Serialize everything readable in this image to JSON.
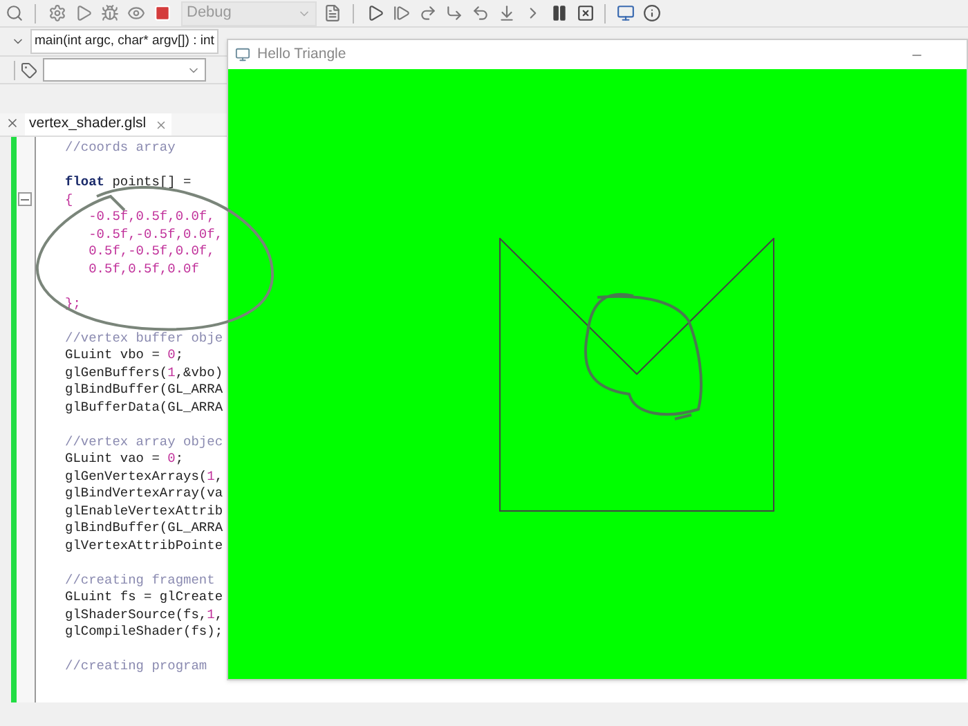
{
  "toolbar": {
    "configuration": {
      "value": "Debug",
      "disabled": true
    }
  },
  "function_selector": {
    "value": "main(int argc, char* argv[]) : int"
  },
  "tabs": [
    {
      "label": "vertex_shader.glsl",
      "selected": true
    }
  ],
  "editor": {
    "blocks": [
      {
        "lines": [
          [
            {
              "kind": "comment",
              "text": "//coords array"
            }
          ]
        ]
      },
      {
        "lines": [
          [
            {
              "kind": "keyword",
              "text": "float"
            },
            {
              "kind": "plain",
              "text": " points[] ="
            }
          ],
          [
            {
              "kind": "number",
              "text": "{"
            }
          ],
          [
            {
              "kind": "number",
              "text": "   -0.5f,0.5f,0.0f,"
            }
          ],
          [
            {
              "kind": "number",
              "text": "   -0.5f,-0.5f,0.0f,"
            }
          ],
          [
            {
              "kind": "number",
              "text": "   0.5f,-0.5f,0.0f,"
            }
          ],
          [
            {
              "kind": "number",
              "text": "   0.5f,0.5f,0.0f"
            }
          ]
        ]
      },
      {
        "lines": [
          [
            {
              "kind": "number",
              "text": "};"
            }
          ]
        ]
      },
      {
        "lines": [
          [
            {
              "kind": "comment",
              "text": "//vertex buffer obje"
            }
          ],
          [
            {
              "kind": "plain",
              "text": "GLuint vbo = "
            },
            {
              "kind": "number",
              "text": "0"
            },
            {
              "kind": "plain",
              "text": ";"
            }
          ],
          [
            {
              "kind": "plain",
              "text": "glGenBuffers("
            },
            {
              "kind": "number",
              "text": "1"
            },
            {
              "kind": "plain",
              "text": ",&vbo)"
            }
          ],
          [
            {
              "kind": "plain",
              "text": "glBindBuffer(GL_ARRA"
            }
          ],
          [
            {
              "kind": "plain",
              "text": "glBufferData(GL_ARRA"
            }
          ]
        ]
      },
      {
        "lines": [
          [
            {
              "kind": "comment",
              "text": "//vertex array objec"
            }
          ],
          [
            {
              "kind": "plain",
              "text": "GLuint vao = "
            },
            {
              "kind": "number",
              "text": "0"
            },
            {
              "kind": "plain",
              "text": ";"
            }
          ],
          [
            {
              "kind": "plain",
              "text": "glGenVertexArrays("
            },
            {
              "kind": "number",
              "text": "1"
            },
            {
              "kind": "plain",
              "text": ","
            }
          ],
          [
            {
              "kind": "plain",
              "text": "glBindVertexArray(va"
            }
          ],
          [
            {
              "kind": "plain",
              "text": "glEnableVertexAttrib"
            }
          ],
          [
            {
              "kind": "plain",
              "text": "glBindBuffer(GL_ARRA"
            }
          ],
          [
            {
              "kind": "plain",
              "text": "glVertexAttribPointe"
            }
          ]
        ]
      },
      {
        "lines": [
          [
            {
              "kind": "comment",
              "text": "//creating fragment"
            }
          ],
          [
            {
              "kind": "plain",
              "text": "GLuint fs = glCreate"
            }
          ],
          [
            {
              "kind": "plain",
              "text": "glShaderSource(fs,"
            },
            {
              "kind": "number",
              "text": "1"
            },
            {
              "kind": "plain",
              "text": ","
            }
          ],
          [
            {
              "kind": "plain",
              "text": "glCompileShader(fs);"
            }
          ]
        ]
      },
      {
        "lines": [
          [
            {
              "kind": "comment",
              "text": "//creating program"
            }
          ]
        ]
      }
    ]
  },
  "window": {
    "title": "Hello Triangle"
  }
}
